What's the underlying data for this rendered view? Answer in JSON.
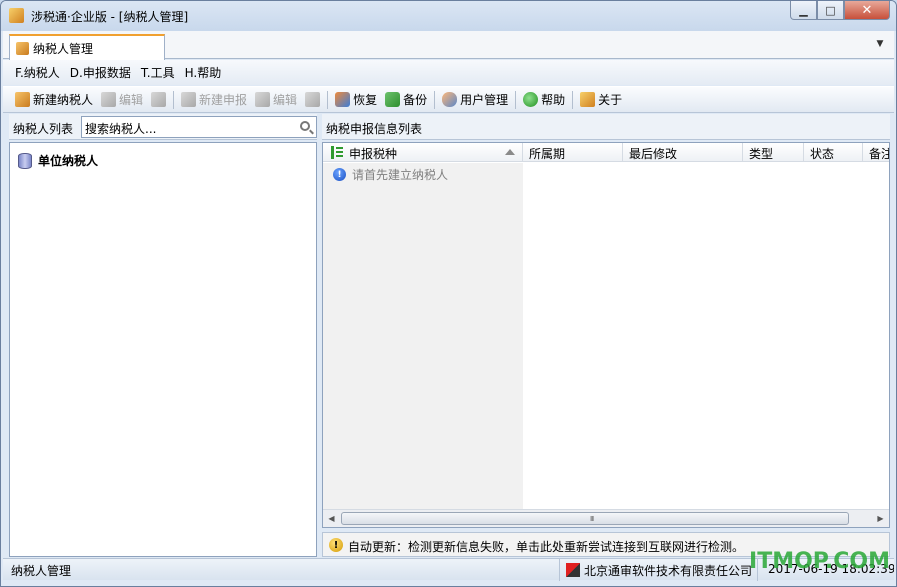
{
  "window": {
    "title": "涉税通·企业版 - [纳税人管理]",
    "controls": {
      "minimize": "▁",
      "maximize": "□",
      "close": "✕"
    }
  },
  "tabs": [
    {
      "label": "纳税人管理",
      "active": true
    }
  ],
  "menu": [
    {
      "label": "F.纳税人"
    },
    {
      "label": "D.申报数据"
    },
    {
      "label": "T.工具"
    },
    {
      "label": "H.帮助"
    }
  ],
  "toolbar": {
    "new_taxpayer": "新建纳税人",
    "edit_taxpayer": "编辑",
    "new_declaration": "新建申报",
    "edit_declaration": "编辑",
    "restore": "恢复",
    "backup": "备份",
    "user_management": "用户管理",
    "help": "帮助",
    "about": "关于"
  },
  "left_panel": {
    "label": "纳税人列表",
    "search_placeholder": "搜索纳税人...",
    "tree": [
      {
        "label": "单位纳税人"
      }
    ]
  },
  "right_panel": {
    "label": "纳税申报信息列表",
    "columns": [
      "申报税种",
      "所属期",
      "最后修改",
      "类型",
      "状态",
      "备注"
    ],
    "empty_message": "请首先建立纳税人",
    "scroll_grip": "III"
  },
  "notification": {
    "text": "自动更新：检测更新信息失败，单击此处重新尝试连接到互联网进行检测。"
  },
  "status_bar": {
    "left": "纳税人管理",
    "company": "北京通审软件技术有限责任公司",
    "datetime": "2017-06-19 18:02:39"
  },
  "watermark": "ITMOP.COM",
  "colors": {
    "accent_tab": "#f0a030",
    "window_bg": "#dfe9f5",
    "notify_icon": "#d49a00",
    "watermark": "#2aa837"
  }
}
